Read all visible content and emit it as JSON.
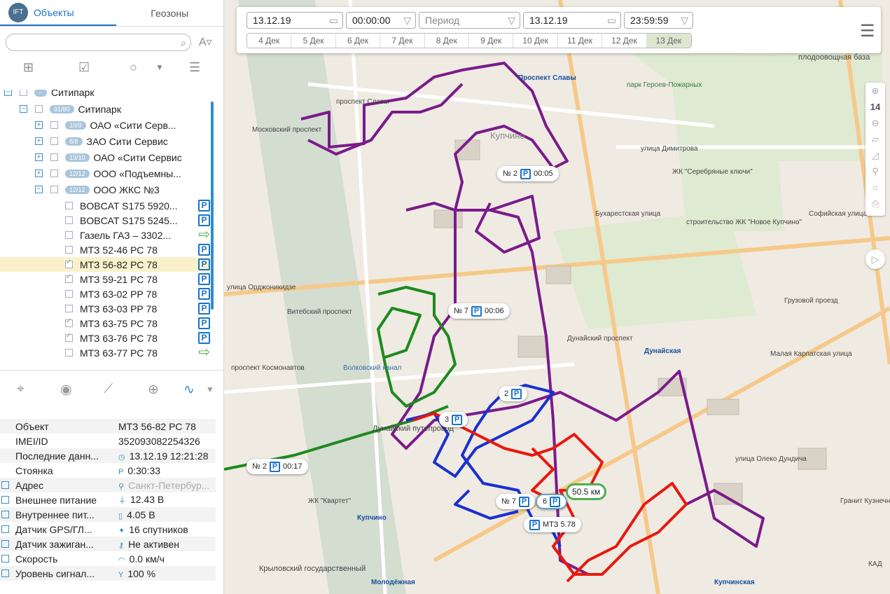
{
  "tabs": {
    "logo": "IFT",
    "objects": "Объекты",
    "geozones": "Геозоны"
  },
  "search": {
    "placeholder": "",
    "sort_label": "A"
  },
  "tree": {
    "top_label": "Ситипарк",
    "group": {
      "count": "91/80",
      "name": "Ситипарк"
    },
    "subgroups": [
      {
        "count": "10/9",
        "name": "ОАО «Сити Серв..."
      },
      {
        "count": "8/8",
        "name": "ЗАО Сити Сервис"
      },
      {
        "count": "13/10",
        "name": "ОАО «Сити Сервис"
      },
      {
        "count": "12/12",
        "name": "ООО «Подъемны..."
      },
      {
        "count": "12/12",
        "name": "ООО ЖКС №3"
      }
    ],
    "objects": [
      {
        "name": "BOBCAT S175 5920...",
        "status": "P",
        "checked": false,
        "selected": false
      },
      {
        "name": "BOBCAT S175 5245...",
        "status": "P",
        "checked": false,
        "selected": false
      },
      {
        "name": "Газель ГАЗ – 3302...",
        "status": "arrow",
        "checked": false,
        "selected": false
      },
      {
        "name": "МТЗ 52-46 РС 78",
        "status": "P",
        "checked": false,
        "selected": false
      },
      {
        "name": "МТЗ 56-82 РС 78",
        "status": "P",
        "checked": true,
        "selected": true
      },
      {
        "name": "МТЗ 59-21 РС 78",
        "status": "P",
        "checked": true,
        "selected": false
      },
      {
        "name": "МТЗ 63-02 РР 78",
        "status": "P",
        "checked": false,
        "selected": false
      },
      {
        "name": "МТЗ 63-03 РР 78",
        "status": "P",
        "checked": false,
        "selected": false
      },
      {
        "name": "МТЗ 63-75 РС 78",
        "status": "P",
        "checked": true,
        "selected": false
      },
      {
        "name": "МТЗ 63-76 РС 78",
        "status": "P",
        "checked": true,
        "selected": false
      },
      {
        "name": "МТЗ 63-77 РС 78",
        "status": "arrow",
        "checked": false,
        "selected": false
      }
    ]
  },
  "props": [
    {
      "label": "Объект",
      "value": "МТЗ 56-82 РС 78",
      "icon": "",
      "cb": false
    },
    {
      "label": "IMEI/ID",
      "value": "352093082254326",
      "icon": "",
      "cb": false
    },
    {
      "label": "Последние данн...",
      "value": "13.12.19 12:21:28",
      "icon": "clock-icon",
      "cb": false
    },
    {
      "label": "Стоянка",
      "value": "0:30:33",
      "icon": "parking-icon",
      "cb": false
    },
    {
      "label": "Адрес",
      "value": "Санкт-Петербур...",
      "icon": "pin-icon",
      "cb": true,
      "muted": true
    },
    {
      "label": "Внешнее питание",
      "value": "12.43 В",
      "icon": "plug-icon",
      "cb": true
    },
    {
      "label": "Внутреннее пит...",
      "value": "4.05 В",
      "icon": "battery-icon",
      "cb": true
    },
    {
      "label": "Датчик GPS/ГЛ...",
      "value": "16 спутников",
      "icon": "satellite-icon",
      "cb": true
    },
    {
      "label": "Датчик зажиган...",
      "value": "Не активен",
      "icon": "key-icon",
      "cb": true
    },
    {
      "label": "Скорость",
      "value": "0.0 км/ч",
      "icon": "speed-icon",
      "cb": true
    },
    {
      "label": "Уровень сигнал...",
      "value": "100 %",
      "icon": "signal-icon",
      "cb": true
    }
  ],
  "controls": {
    "date_from": "13.12.19",
    "time_from": "00:00:00",
    "period_placeholder": "Период",
    "date_to": "13.12.19",
    "time_to": "23:59:59",
    "days": [
      "4 Дек",
      "5 Дек",
      "6 Дек",
      "7 Дек",
      "8 Дек",
      "9 Дек",
      "10 Дек",
      "11 Дек",
      "12 Дек",
      "13 Дек"
    ],
    "active_day": "13 Дек"
  },
  "zoom_level": "14",
  "map_labels": [
    {
      "t": "Проспект Славы",
      "b": true
    },
    {
      "t": "Купчино"
    },
    {
      "t": "улица Димитрова"
    },
    {
      "t": "парк Героев-Пожарных"
    },
    {
      "t": "плодоовощная база"
    },
    {
      "t": "Дунайская",
      "b": true
    },
    {
      "t": "Купчино",
      "b": true
    },
    {
      "t": "Молодёжная",
      "b": true
    },
    {
      "t": "Купчинская",
      "b": true
    },
    {
      "t": "Крыловский государственный"
    },
    {
      "t": "ЖК \"Квартет\""
    },
    {
      "t": "Грузовой проезд"
    },
    {
      "t": "Дунайский проспект"
    },
    {
      "t": "улица Олеко Дундича"
    },
    {
      "t": "Волковский канал"
    },
    {
      "t": "Витебский проспект"
    },
    {
      "t": "Московский проспект"
    },
    {
      "t": "Бухарестская улица"
    },
    {
      "t": "Софийская улица"
    },
    {
      "t": "Малая Карпатская улица"
    },
    {
      "t": "проспект Славы"
    },
    {
      "t": "ЖК \"Серебряные ключи\""
    },
    {
      "t": "строительство ЖК \"Новое Купчино\""
    },
    {
      "t": "улица Орджоникидзе"
    },
    {
      "t": "проспект Космонавтов"
    },
    {
      "t": "Дунайский путепровод"
    },
    {
      "t": "Гранит Кузнечно склад \"Софи"
    },
    {
      "t": "КАД"
    }
  ],
  "popups": [
    {
      "num": "№ 2",
      "time": "00:05"
    },
    {
      "num": "№ 7",
      "time": "00:06"
    },
    {
      "num": "№ 2",
      "time": "00:17"
    },
    {
      "num": "2",
      "time": ""
    },
    {
      "num": "3",
      "time": ""
    },
    {
      "num": "№ 7",
      "time": ""
    },
    {
      "num": "6",
      "time": ""
    },
    {
      "num": "МТЗ 5.78",
      "time": ""
    }
  ],
  "distance": "50.5 км",
  "colors": {
    "accent": "#1a73c8",
    "purple": "#7b1a8c",
    "green": "#1e8a1e",
    "blue": "#1a2fd0",
    "red": "#e8180f"
  }
}
